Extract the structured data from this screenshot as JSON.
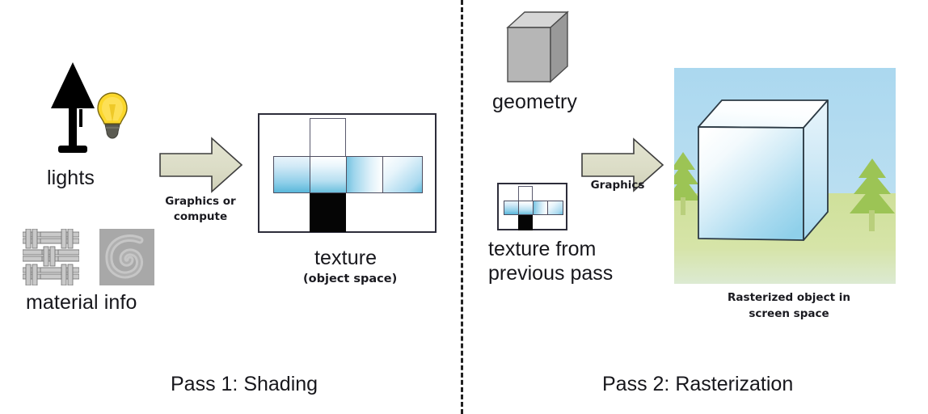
{
  "diagram": {
    "title_left": "Pass 1: Shading",
    "title_right": "Pass 2: Rasterization",
    "divider_style": "vertical dashed line"
  },
  "left_panel": {
    "inputs": {
      "lights_label": "lights",
      "lights_icons": [
        "table-lamp-icon",
        "light-bulb-icon"
      ],
      "material_label": "material info",
      "material_icons": [
        "basket-weave-swatch",
        "gray-spiral-swatch"
      ]
    },
    "arrow": {
      "label_line1": "Graphics or",
      "label_line2": "compute",
      "direction": "right",
      "fill": "#dcddc7"
    },
    "output": {
      "label": "texture",
      "sublabel": "(object space)",
      "graphic": "cube-uv-unwrap"
    },
    "caption": "Pass 1: Shading"
  },
  "right_panel": {
    "inputs": {
      "geometry_label": "geometry",
      "geometry_icon": "gray-3d-cube",
      "texture_label_line1": "texture from",
      "texture_label_line2": "previous pass",
      "texture_icon": "cube-uv-unwrap-thumbnail"
    },
    "arrow": {
      "label_line1": "Graphics",
      "direction": "right",
      "fill": "#dcddc7"
    },
    "output": {
      "caption_line1": "Rasterized object in",
      "caption_line2": "screen space",
      "graphic": "rendered-scene-with-cube-and-trees"
    },
    "caption": "Pass 2: Rasterization"
  },
  "colors": {
    "arrow_fill": "#dcddc7",
    "arrow_stroke": "#3c3c3c",
    "sky": "#b0daf0",
    "ground": "#d3e2a2",
    "tree": "#9cc455",
    "cube_face_gradient_from": "#ffffff",
    "cube_face_gradient_to": "#8fd0ea",
    "texture_black_face": "#050505",
    "geometry_cube_gray": "#b3b3b3",
    "ink": "#17171c"
  }
}
